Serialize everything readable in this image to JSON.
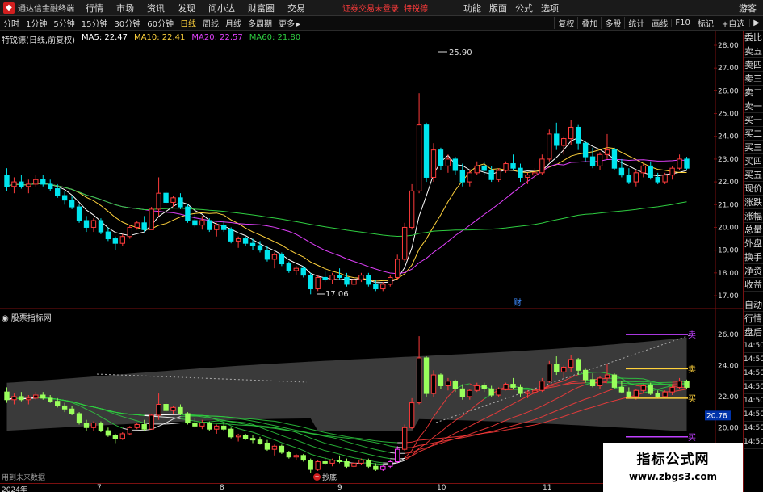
{
  "menubar": {
    "app_title": "通达信金融终端",
    "menus": [
      "行情",
      "市场",
      "资讯",
      "发现",
      "问小达",
      "财富圈",
      "交易"
    ],
    "login_status": "证券交易未登录",
    "stock_name": "特锐德",
    "right_menus": [
      "功能",
      "版面",
      "公式",
      "选项"
    ],
    "guest": "游客"
  },
  "toolbar": {
    "periods": [
      "分时",
      "1分钟",
      "5分钟",
      "15分钟",
      "30分钟",
      "60分钟",
      "日线",
      "周线",
      "月线",
      "多周期",
      "更多"
    ],
    "active_period": "日线",
    "right_buttons": [
      "复权",
      "叠加",
      "多股",
      "统计",
      "画线",
      "F10",
      "标记"
    ],
    "self_pick": "+自选"
  },
  "title_line": {
    "name": "特锐德(日线,前复权)",
    "ma5": "MA5: 22.47",
    "ma10": "MA10: 22.41",
    "ma20": "MA20: 22.57",
    "ma60": "MA60: 21.80"
  },
  "colors": {
    "up": "#ff3b3b",
    "down": "#00e5ee",
    "ma5": "#ffffff",
    "ma10": "#ffd23c",
    "ma20": "#e040fb",
    "ma60": "#2ecc40",
    "title_name": "#dddddd"
  },
  "main_axis": {
    "labels": [
      "28.00",
      "27.00",
      "26.00",
      "25.00",
      "24.00",
      "23.00",
      "22.00",
      "21.00",
      "20.00",
      "19.00",
      "18.00",
      "17.00"
    ],
    "high_label": "25.90",
    "low_label": "17.06",
    "marker_cai": "财"
  },
  "indicator": {
    "title": "股票指标网",
    "axis_labels": [
      "26.00",
      "24.00",
      "22.00",
      "20.00"
    ],
    "price_tag": "20.78",
    "top_mark": "卖",
    "bottom_mark": "买",
    "buy_label": "抄底",
    "future_data": "用到未来数据"
  },
  "x_axis": {
    "labels": [
      "2024年",
      "7",
      "8",
      "9",
      "10",
      "11"
    ]
  },
  "right_panel": {
    "items": [
      "委比",
      "卖五",
      "卖四",
      "卖三",
      "卖二",
      "卖一",
      "买一",
      "买二",
      "买三",
      "买四",
      "买五",
      "现价",
      "涨跌",
      "涨幅",
      "总量",
      "外盘",
      "换手",
      "净资",
      "收益"
    ],
    "items2": [
      "自动",
      "行情",
      "盘后",
      "14:50",
      "14:50",
      "14:50",
      "14:50",
      "14:50",
      "14:50",
      "14:50",
      "14:50"
    ]
  },
  "watermark": {
    "main": "指标公式网",
    "url": "www.zbgs3.com"
  },
  "chart_data": {
    "type": "candlestick",
    "ohlc": [
      [
        22.3,
        22.6,
        21.6,
        21.8
      ],
      [
        21.8,
        22.2,
        21.5,
        22.0
      ],
      [
        22.0,
        22.3,
        21.7,
        21.8
      ],
      [
        21.8,
        22.1,
        21.5,
        21.9
      ],
      [
        21.9,
        22.3,
        21.8,
        22.1
      ],
      [
        22.1,
        22.3,
        21.8,
        21.9
      ],
      [
        21.9,
        22.1,
        21.6,
        21.7
      ],
      [
        21.7,
        21.9,
        21.3,
        21.4
      ],
      [
        21.4,
        21.6,
        21.0,
        21.2
      ],
      [
        21.2,
        21.4,
        20.8,
        20.9
      ],
      [
        20.9,
        21.0,
        20.2,
        20.3
      ],
      [
        20.3,
        20.5,
        19.8,
        20.0
      ],
      [
        20.0,
        20.4,
        19.8,
        20.3
      ],
      [
        20.3,
        20.4,
        19.7,
        19.8
      ],
      [
        19.8,
        20.0,
        19.4,
        19.5
      ],
      [
        19.5,
        19.6,
        19.0,
        19.3
      ],
      [
        19.3,
        19.7,
        19.2,
        19.6
      ],
      [
        19.6,
        20.1,
        19.5,
        20.0
      ],
      [
        20.0,
        20.3,
        19.9,
        20.2
      ],
      [
        20.2,
        20.5,
        19.8,
        19.9
      ],
      [
        19.9,
        20.9,
        19.9,
        20.8
      ],
      [
        20.8,
        22.2,
        20.5,
        21.5
      ],
      [
        21.5,
        21.6,
        21.0,
        21.1
      ],
      [
        21.1,
        21.4,
        20.9,
        21.3
      ],
      [
        21.3,
        21.5,
        20.8,
        20.9
      ],
      [
        20.9,
        21.0,
        20.2,
        20.3
      ],
      [
        20.3,
        20.6,
        20.0,
        20.1
      ],
      [
        20.1,
        20.5,
        19.9,
        20.3
      ],
      [
        20.3,
        20.4,
        19.8,
        19.9
      ],
      [
        19.9,
        20.2,
        19.6,
        20.1
      ],
      [
        20.1,
        20.3,
        19.8,
        19.9
      ],
      [
        19.9,
        20.0,
        19.3,
        19.4
      ],
      [
        19.4,
        19.6,
        19.1,
        19.5
      ],
      [
        19.5,
        19.6,
        19.2,
        19.3
      ],
      [
        19.3,
        19.5,
        19.0,
        19.2
      ],
      [
        19.2,
        19.4,
        18.9,
        19.0
      ],
      [
        19.0,
        19.2,
        18.5,
        18.6
      ],
      [
        18.6,
        18.9,
        18.2,
        18.8
      ],
      [
        18.8,
        18.9,
        18.3,
        18.4
      ],
      [
        18.4,
        18.5,
        18.0,
        18.1
      ],
      [
        18.1,
        18.3,
        17.9,
        18.2
      ],
      [
        18.2,
        18.3,
        17.8,
        17.9
      ],
      [
        17.9,
        18.0,
        17.06,
        17.3
      ],
      [
        17.3,
        17.9,
        17.2,
        17.8
      ],
      [
        17.8,
        18.1,
        17.6,
        17.7
      ],
      [
        17.7,
        18.0,
        17.5,
        17.9
      ],
      [
        17.9,
        18.2,
        17.7,
        17.8
      ],
      [
        17.8,
        18.0,
        17.4,
        17.5
      ],
      [
        17.5,
        17.8,
        17.4,
        17.7
      ],
      [
        17.7,
        18.0,
        17.6,
        17.9
      ],
      [
        17.9,
        18.0,
        17.4,
        17.5
      ],
      [
        17.5,
        17.7,
        17.2,
        17.3
      ],
      [
        17.3,
        17.6,
        17.2,
        17.5
      ],
      [
        17.5,
        17.9,
        17.4,
        17.8
      ],
      [
        17.8,
        18.8,
        17.7,
        18.6
      ],
      [
        18.6,
        20.2,
        18.5,
        20.0
      ],
      [
        20.0,
        21.9,
        19.9,
        21.6
      ],
      [
        21.6,
        25.9,
        21.5,
        24.5
      ],
      [
        24.5,
        24.6,
        22.0,
        22.2
      ],
      [
        22.2,
        23.7,
        22.0,
        23.4
      ],
      [
        23.4,
        23.5,
        22.5,
        22.7
      ],
      [
        22.7,
        23.2,
        22.4,
        23.0
      ],
      [
        23.0,
        23.1,
        22.3,
        22.5
      ],
      [
        22.5,
        22.8,
        21.8,
        22.0
      ],
      [
        22.0,
        22.5,
        21.8,
        22.4
      ],
      [
        22.4,
        22.9,
        22.3,
        22.7
      ],
      [
        22.7,
        22.9,
        22.3,
        22.5
      ],
      [
        22.5,
        22.7,
        22.0,
        22.1
      ],
      [
        22.1,
        22.6,
        22.0,
        22.5
      ],
      [
        22.5,
        22.9,
        22.4,
        22.8
      ],
      [
        22.8,
        23.2,
        22.5,
        22.6
      ],
      [
        22.6,
        22.8,
        22.0,
        22.2
      ],
      [
        22.2,
        22.4,
        21.9,
        22.3
      ],
      [
        22.3,
        22.6,
        22.1,
        22.4
      ],
      [
        22.4,
        23.2,
        22.3,
        23.0
      ],
      [
        23.0,
        24.3,
        22.9,
        24.1
      ],
      [
        24.1,
        24.6,
        23.4,
        23.6
      ],
      [
        23.6,
        24.0,
        23.2,
        23.9
      ],
      [
        23.9,
        24.7,
        23.6,
        24.4
      ],
      [
        24.4,
        24.5,
        23.4,
        23.7
      ],
      [
        23.7,
        23.8,
        22.9,
        23.1
      ],
      [
        23.1,
        23.5,
        22.6,
        22.7
      ],
      [
        22.7,
        23.3,
        22.5,
        23.2
      ],
      [
        23.2,
        24.1,
        23.0,
        23.4
      ],
      [
        23.4,
        23.5,
        22.5,
        22.6
      ],
      [
        22.6,
        23.0,
        22.2,
        22.3
      ],
      [
        22.3,
        22.6,
        21.9,
        22.0
      ],
      [
        22.0,
        22.5,
        21.8,
        22.4
      ],
      [
        22.4,
        22.8,
        22.2,
        22.7
      ],
      [
        22.7,
        22.9,
        22.1,
        22.2
      ],
      [
        22.2,
        22.4,
        21.9,
        22.0
      ],
      [
        22.0,
        22.4,
        21.9,
        22.3
      ],
      [
        22.3,
        22.7,
        22.1,
        22.6
      ],
      [
        22.6,
        23.2,
        22.5,
        23.0
      ],
      [
        23.0,
        23.1,
        22.5,
        22.6
      ]
    ],
    "ylim": [
      17.0,
      28.0
    ]
  }
}
